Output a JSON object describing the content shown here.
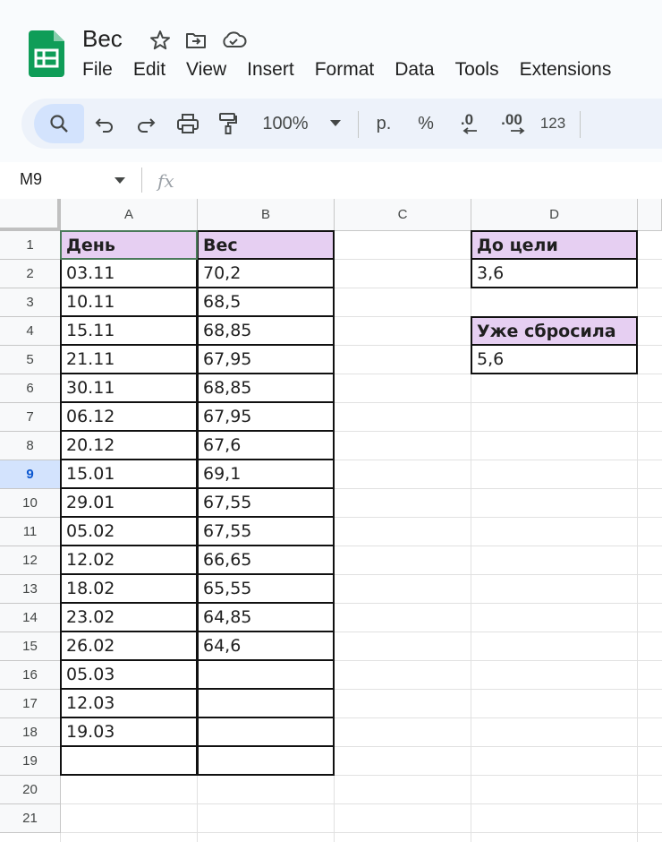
{
  "app": {
    "doc_title": "Вес",
    "icons": [
      "sheets-logo-icon",
      "star-icon",
      "move-to-folder-icon",
      "cloud-status-icon"
    ]
  },
  "menu": [
    "File",
    "Edit",
    "View",
    "Insert",
    "Format",
    "Data",
    "Tools",
    "Extensions"
  ],
  "toolbar": {
    "zoom": "100%",
    "currency": "р.",
    "percent": "%",
    "decrease_decimals": ".0",
    "increase_decimals": ".00",
    "number_format": "123"
  },
  "formula_bar": {
    "name_box": "M9",
    "fx_label": "fx",
    "formula": ""
  },
  "sheet": {
    "columns": [
      "A",
      "B",
      "C",
      "D"
    ],
    "rows": [
      "1",
      "2",
      "3",
      "4",
      "5",
      "6",
      "7",
      "8",
      "9",
      "10",
      "11",
      "12",
      "13",
      "14",
      "15",
      "16",
      "17",
      "18",
      "19",
      "20",
      "21"
    ],
    "selected_row": "9",
    "table": {
      "headers": [
        "День",
        "Вес"
      ],
      "rows": [
        [
          "03.11",
          "70,2"
        ],
        [
          "10.11",
          "68,5"
        ],
        [
          "15.11",
          "68,85"
        ],
        [
          "21.11",
          "67,95"
        ],
        [
          "30.11",
          "68,85"
        ],
        [
          "06.12",
          "67,95"
        ],
        [
          "20.12",
          "67,6"
        ],
        [
          "15.01",
          "69,1"
        ],
        [
          "29.01",
          "67,55"
        ],
        [
          "05.02",
          "67,55"
        ],
        [
          "12.02",
          "66,65"
        ],
        [
          "18.02",
          "65,55"
        ],
        [
          "23.02",
          "64,85"
        ],
        [
          "26.02",
          "64,6"
        ],
        [
          "05.03",
          ""
        ],
        [
          "12.03",
          ""
        ],
        [
          "19.03",
          ""
        ],
        [
          "",
          ""
        ]
      ]
    },
    "summary": [
      {
        "label": "До цели",
        "value": "3,6"
      },
      {
        "label": "Уже сбросила",
        "value": "5,6"
      }
    ]
  },
  "colors": {
    "header_fill": "#e6cff2",
    "topbar_bg": "#f9fbfd",
    "toolbar_bg": "#edf2fa",
    "selected_row": "#d3e3fd",
    "sheets_green": "#0f9d58"
  }
}
